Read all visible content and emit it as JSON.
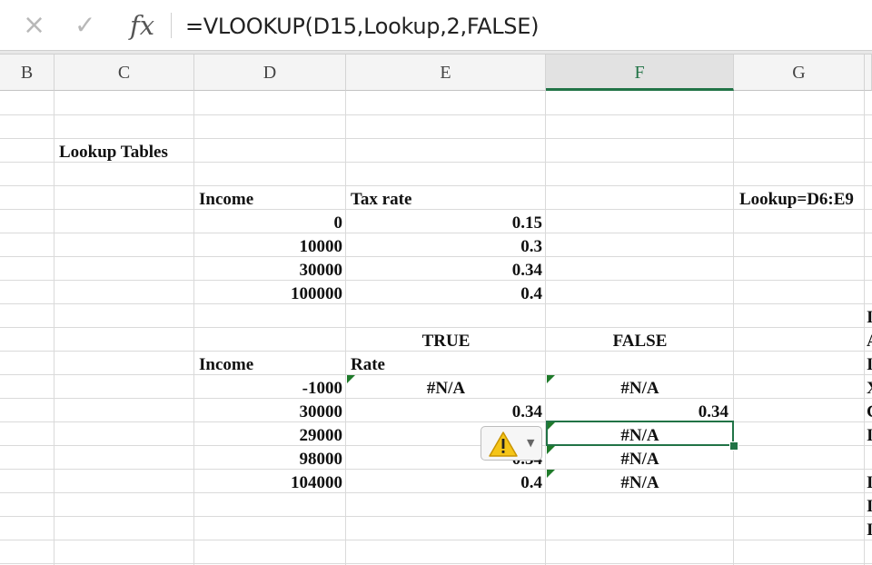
{
  "formula_bar": {
    "cancel_icon": "×",
    "enter_icon": "✓",
    "fx_label": "fx",
    "formula": "=VLOOKUP(D15,Lookup,2,FALSE)"
  },
  "columns": [
    {
      "label": "B",
      "selected": false
    },
    {
      "label": "C",
      "selected": false
    },
    {
      "label": "D",
      "selected": false
    },
    {
      "label": "E",
      "selected": false
    },
    {
      "label": "F",
      "selected": true
    },
    {
      "label": "G",
      "selected": false
    }
  ],
  "colors": {
    "accent": "#217346",
    "error_flag": "#1f7a2a",
    "warning_fill": "#f5c518"
  },
  "sheet": {
    "section_title": "Lookup Tables",
    "table1": {
      "header_income": "Income",
      "header_rate": "Tax rate",
      "name_note": "Lookup=D6:E9",
      "rows": [
        {
          "income": "0",
          "rate": "0.15"
        },
        {
          "income": "10000",
          "rate": "0.3"
        },
        {
          "income": "30000",
          "rate": "0.34"
        },
        {
          "income": "100000",
          "rate": "0.4"
        }
      ]
    },
    "table2": {
      "header_true": "TRUE",
      "header_false": "FALSE",
      "header_income": "Income",
      "header_rate": "Rate",
      "rows": [
        {
          "income": "-1000",
          "true_val": "#N/A",
          "false_val": "#N/A",
          "g_val": ""
        },
        {
          "income": "30000",
          "true_val": "0.34",
          "false_val": "",
          "g_val": "0.34"
        },
        {
          "income": "29000",
          "true_val": "",
          "false_val": "#N/A",
          "g_val": ""
        },
        {
          "income": "98000",
          "true_val": "0.34",
          "false_val": "#N/A",
          "g_val": ""
        },
        {
          "income": "104000",
          "true_val": "0.4",
          "false_val": "#N/A",
          "g_val": ""
        }
      ]
    }
  }
}
